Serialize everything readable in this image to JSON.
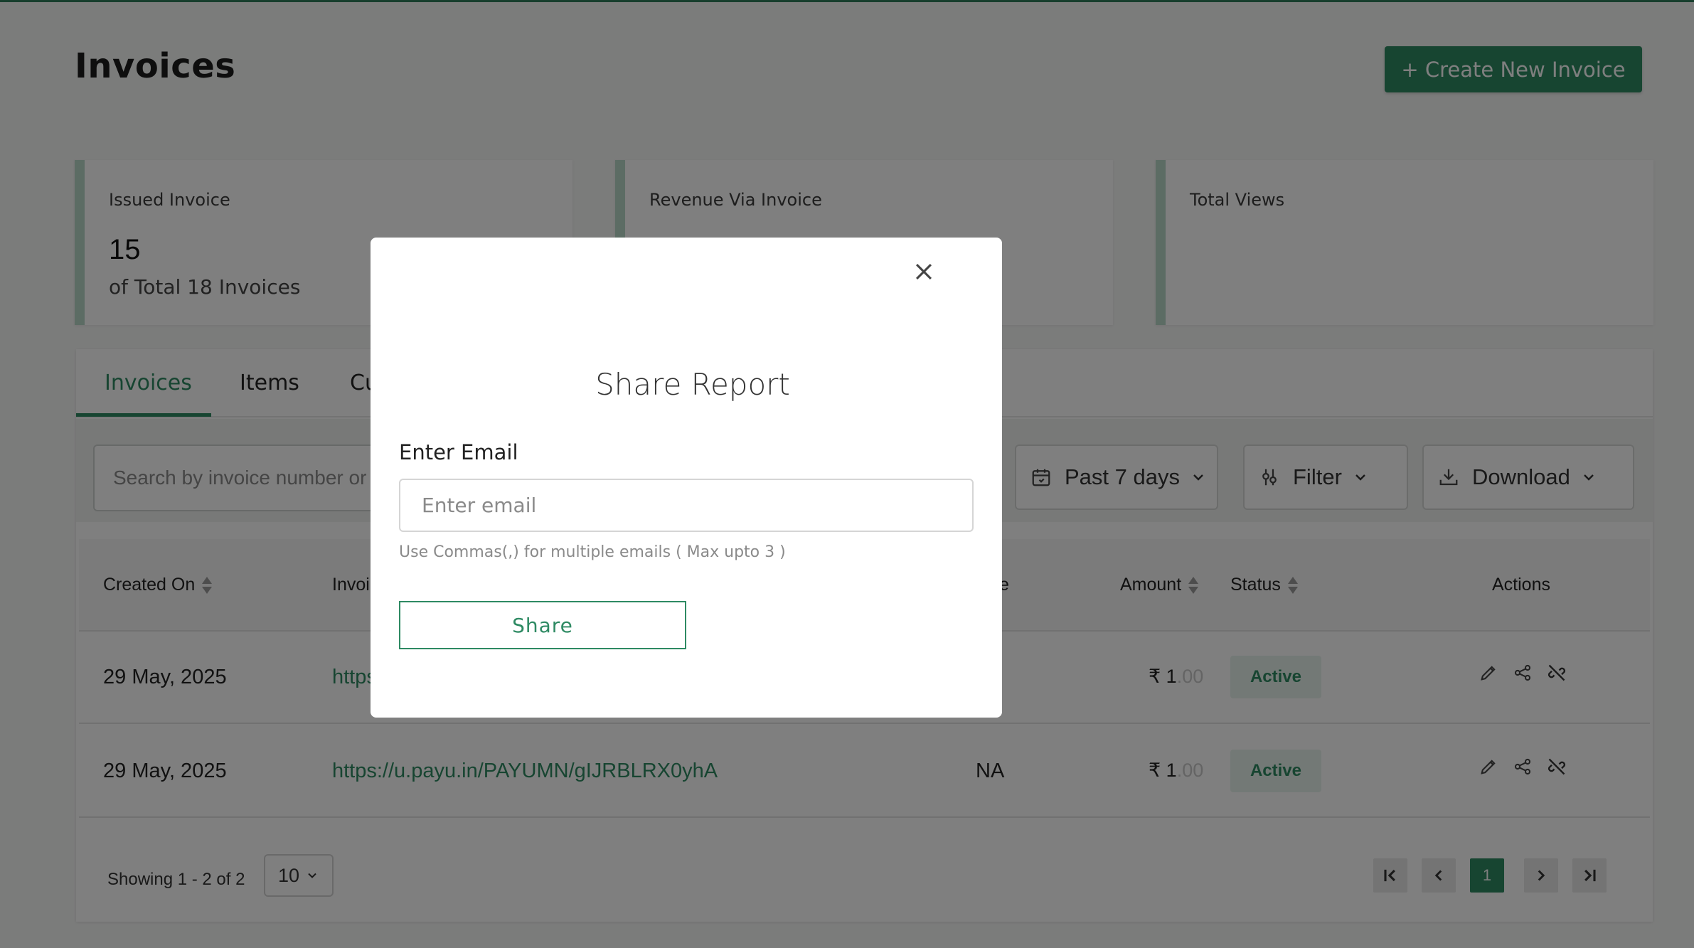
{
  "header": {
    "title": "Invoices",
    "create_button": "+ Create New Invoice"
  },
  "cards": [
    {
      "label": "Issued Invoice",
      "value": "15",
      "sub": "of Total 18 Invoices"
    },
    {
      "label": "Revenue Via Invoice",
      "value": "",
      "sub": ""
    },
    {
      "label": "Total Views",
      "value": "",
      "sub": ""
    }
  ],
  "tabs": [
    {
      "label": "Invoices",
      "active": true
    },
    {
      "label": "Items",
      "active": false
    },
    {
      "label": "Cu",
      "active": false
    }
  ],
  "toolbar": {
    "search_placeholder": "Search by invoice number or",
    "date_range": "Past 7 days",
    "filter": "Filter",
    "download": "Download"
  },
  "table": {
    "columns": {
      "created_on": "Created On",
      "invoice": "Invoi",
      "due_date": "e",
      "amount": "Amount",
      "status": "Status",
      "actions": "Actions"
    },
    "rows": [
      {
        "created_on": "29 May, 2025",
        "invoice": "https",
        "due_date": "",
        "amount_symbol": "₹ 1",
        "amount_decimal": ".00",
        "status": "Active"
      },
      {
        "created_on": "29 May, 2025",
        "invoice": "https://u.payu.in/PAYUMN/gIJRBLRX0yhA",
        "due_date": "NA",
        "amount_symbol": "₹ 1",
        "amount_decimal": ".00",
        "status": "Active"
      }
    ]
  },
  "footer": {
    "showing": "Showing 1 - 2 of 2",
    "page_size": "10",
    "current_page": "1"
  },
  "modal": {
    "title": "Share Report",
    "email_label": "Enter Email",
    "email_placeholder": "Enter email",
    "hint": "Use Commas(,) for multiple emails ( Max upto 3 )",
    "share_button": "Share"
  },
  "colors": {
    "primary": "#2e8a63",
    "overlay": "rgba(0,0,0,0.5)"
  }
}
